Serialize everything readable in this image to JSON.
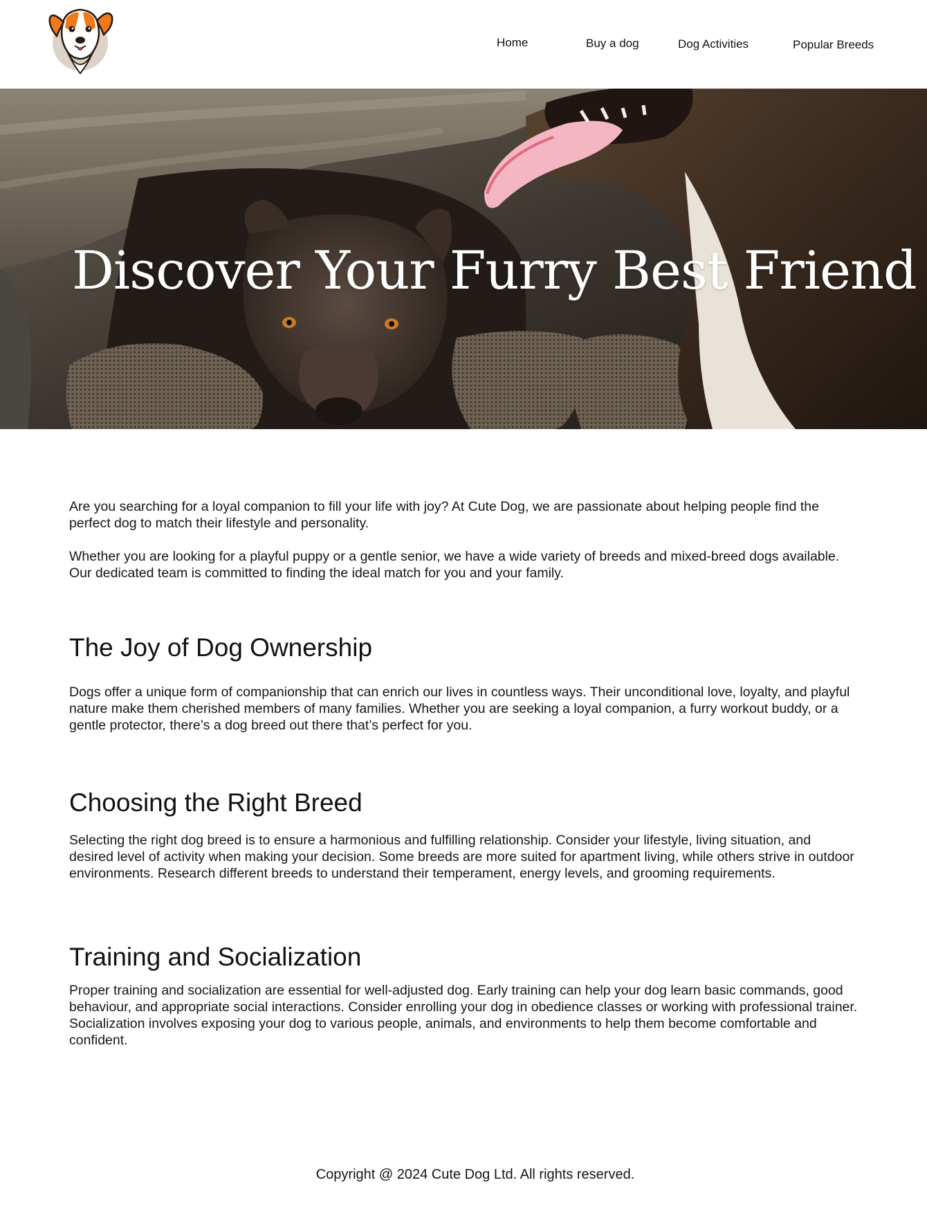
{
  "header": {
    "logo_icon": "dog-head-logo",
    "nav": {
      "home": "Home",
      "buy": "Buy a dog",
      "activities": "Dog Activities",
      "breeds": "Popular Breeds"
    }
  },
  "hero": {
    "title": "Discover Your Furry Best Friend",
    "image": "two-dogs-under-blanket-photo"
  },
  "intro": {
    "p1": "Are you searching for a loyal companion to fill your life with joy? At Cute Dog, we are passionate about helping people find  the perfect dog to match their lifestyle and personality.",
    "p2": "Whether you are looking for a playful puppy or a gentle senior, we have a wide variety of breeds and mixed-breed dogs available. Our dedicated team is committed to finding the ideal match for you and your family."
  },
  "sections": [
    {
      "heading": "The Joy of Dog Ownership",
      "body": "Dogs offer a unique form of companionship that can enrich our lives in countless ways. Their unconditional love, loyalty, and playful nature make them cherished members of many families. Whether you are seeking a loyal companion, a furry workout buddy, or a gentle protector, there’s a dog breed out there that’s perfect for you."
    },
    {
      "heading": "Choosing the Right Breed",
      "body": "Selecting the right dog breed is to ensure a harmonious and fulfilling relationship. Consider your lifestyle, living situation, and desired level of activity when making your decision. Some breeds are more suited for apartment living, while others strive in outdoor environments. Research different breeds to understand their temperament, energy levels, and grooming requirements."
    },
    {
      "heading": "Training and Socialization",
      "body": "Proper training and socialization are essential for well-adjusted dog. Early training can help your dog learn basic commands, good behaviour, and appropriate social interactions. Consider enrolling your dog in obedience classes or working with professional trainer.  Socialization involves exposing your dog to various people, animals, and environments to help them become comfortable and confident."
    }
  ],
  "footer": {
    "copyright": "Copyright @ 2024 Cute Dog Ltd. All rights reserved."
  },
  "colors": {
    "background": "#ffffff",
    "text": "#111111",
    "logo_orange": "#f07a1a",
    "logo_circle": "#dcd2c8"
  }
}
